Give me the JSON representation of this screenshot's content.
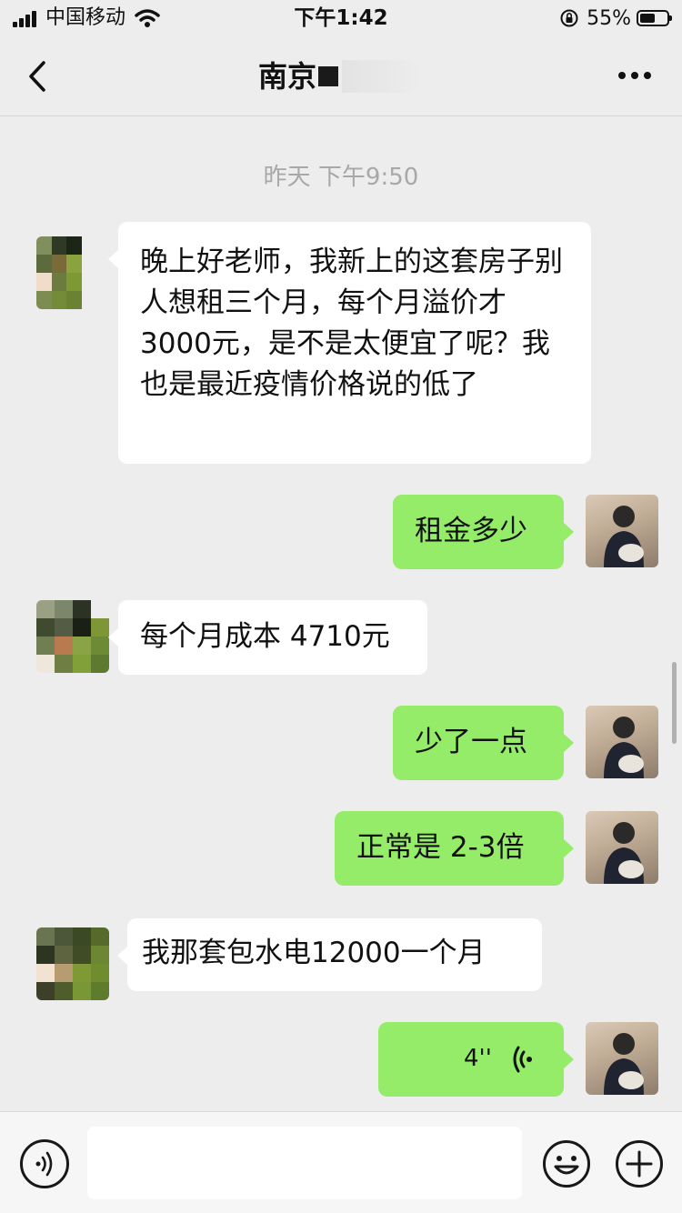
{
  "status_bar": {
    "carrier": "中国移动",
    "time": "下午1:42",
    "battery": "55%"
  },
  "nav": {
    "title": "南京"
  },
  "time_divider": "昨天 下午9:50",
  "messages": [
    {
      "side": "in",
      "text": "晚上好老师，我新上的这套房子别人想租三个月，每个月溢价才 3000元，是不是太便宜了呢？我也是最近疫情价格说的低了"
    },
    {
      "side": "out",
      "text": "租金多少"
    },
    {
      "side": "in",
      "text": "每个月成本 4710元"
    },
    {
      "side": "out",
      "text": "少了一点"
    },
    {
      "side": "out",
      "text": "正常是 2-3倍"
    },
    {
      "side": "in",
      "text": "我那套包水电12000一个月"
    },
    {
      "side": "out",
      "type": "voice",
      "duration": "4''"
    }
  ],
  "colors": {
    "incoming_bubble": "#ffffff",
    "outgoing_bubble": "#95ec69",
    "background": "#ededed"
  },
  "icons": [
    "back-icon",
    "more-icon",
    "voice-icon",
    "emoji-icon",
    "plus-icon"
  ]
}
